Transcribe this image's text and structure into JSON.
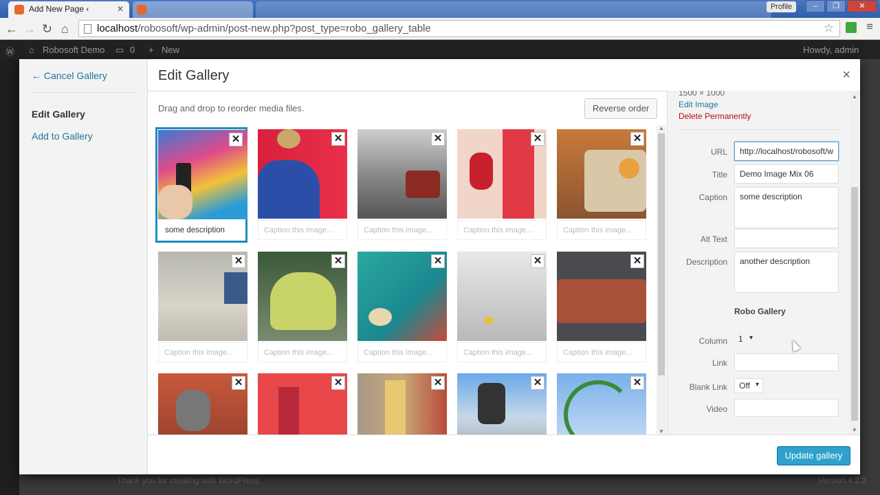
{
  "browser": {
    "active_tab_title": "Add New Page ‹",
    "url_host": "localhost",
    "url_path": "/robosoft/wp-admin/post-new.php?post_type=robo_gallery_table",
    "profile_label": "Profile",
    "window_buttons": [
      "–",
      "❐",
      "✕"
    ]
  },
  "adminbar": {
    "site_name": "Robosoft Demo",
    "comments_count": "0",
    "new_label": "New",
    "greeting": "Howdy, admin"
  },
  "footer": {
    "thanks": "Thank you for creating with WordPress.",
    "version": "Version 4.2.2"
  },
  "modal": {
    "cancel_label": "← Cancel Gallery",
    "menu_items": [
      "Edit Gallery",
      "Add to Gallery"
    ],
    "title": "Edit Gallery",
    "close_label": "×",
    "instructions": "Drag and drop to reorder media files.",
    "reverse_label": "Reverse order",
    "caption_placeholder": "Caption this image...",
    "selected_caption": "some description",
    "remove_label": "✕",
    "update_label": "Update gallery",
    "colors": {
      "accent": "#1e8cbe",
      "button": "#2ea2cc",
      "delete": "#bc0b0b"
    }
  },
  "sidebar": {
    "dimensions": "1500 × 1000",
    "edit_image": "Edit Image",
    "delete_permanently": "Delete Permanently",
    "url_label": "URL",
    "url_value": "http://localhost/robosoft/w",
    "title_label": "Title",
    "title_value": "Demo Image Mix 06",
    "caption_label": "Caption",
    "caption_value": "some description",
    "alt_label": "Alt Text",
    "alt_value": "",
    "description_label": "Description",
    "description_value": "another description",
    "section_title": "Robo Gallery",
    "column_label": "Column",
    "column_value": "1",
    "link_label": "Link",
    "link_value": "",
    "blank_link_label": "Blank Link",
    "blank_link_value": "Off",
    "video_label": "Video",
    "video_value": ""
  }
}
